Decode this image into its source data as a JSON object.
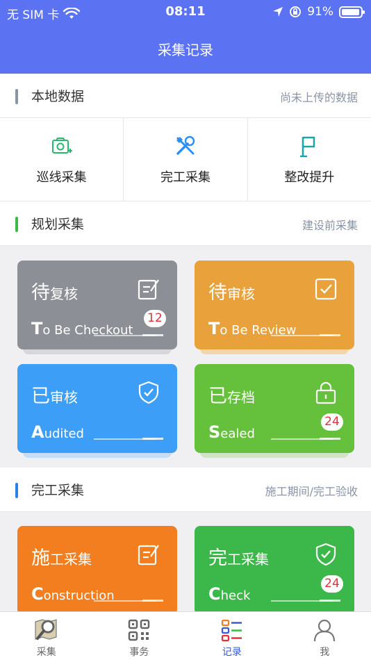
{
  "status": {
    "carrier": "无 SIM 卡",
    "time": "08:11",
    "battery": "91%"
  },
  "nav": {
    "title": "采集记录"
  },
  "local": {
    "title": "本地数据",
    "subtitle": "尚未上传的数据",
    "accent": "#8a94a6",
    "items": [
      {
        "label": "巡线采集",
        "icon": "camera-icon",
        "color": "#27b86c"
      },
      {
        "label": "完工采集",
        "icon": "tools-icon",
        "color": "#2f8ff0"
      },
      {
        "label": "整改提升",
        "icon": "flag-icon",
        "color": "#1aa6a8"
      }
    ]
  },
  "plan": {
    "title": "规划采集",
    "subtitle": "建设前采集",
    "accent": "#3cb84a",
    "cards": [
      {
        "big": "待",
        "small": "复核",
        "en_first": "T",
        "en_rest": "o Be Checkout",
        "badge": "12",
        "icon": "edit-icon",
        "color": "#8d8f96"
      },
      {
        "big": "待",
        "small": "审核",
        "en_first": "T",
        "en_rest": "o Be Review",
        "badge": "",
        "icon": "check-square-icon",
        "color": "#e9a23b"
      },
      {
        "big": "已",
        "small": "审核",
        "en_first": "A",
        "en_rest": "udited",
        "badge": "",
        "icon": "shield-check-icon",
        "color": "#3d9ef7"
      },
      {
        "big": "已",
        "small": "存档",
        "en_first": "S",
        "en_rest": "ealed",
        "badge": "24",
        "icon": "lock-icon",
        "color": "#65c13b"
      }
    ]
  },
  "finish": {
    "title": "完工采集",
    "subtitle": "施工期间/完工验收",
    "accent": "#2f7fe8",
    "cards": [
      {
        "big": "施",
        "small": "工采集",
        "en_first": "C",
        "en_rest": "onstruction",
        "badge": "",
        "icon": "edit-icon",
        "color": "#f27e1f"
      },
      {
        "big": "完",
        "small": "工采集",
        "en_first": "C",
        "en_rest": "heck",
        "badge": "24",
        "icon": "shield-check-icon",
        "color": "#3cb84a"
      }
    ]
  },
  "tabs": [
    {
      "label": "采集",
      "icon": "map-search-icon"
    },
    {
      "label": "事务",
      "icon": "qr-code-icon"
    },
    {
      "label": "记录",
      "icon": "list-icon",
      "active": true
    },
    {
      "label": "我",
      "icon": "user-icon"
    }
  ]
}
